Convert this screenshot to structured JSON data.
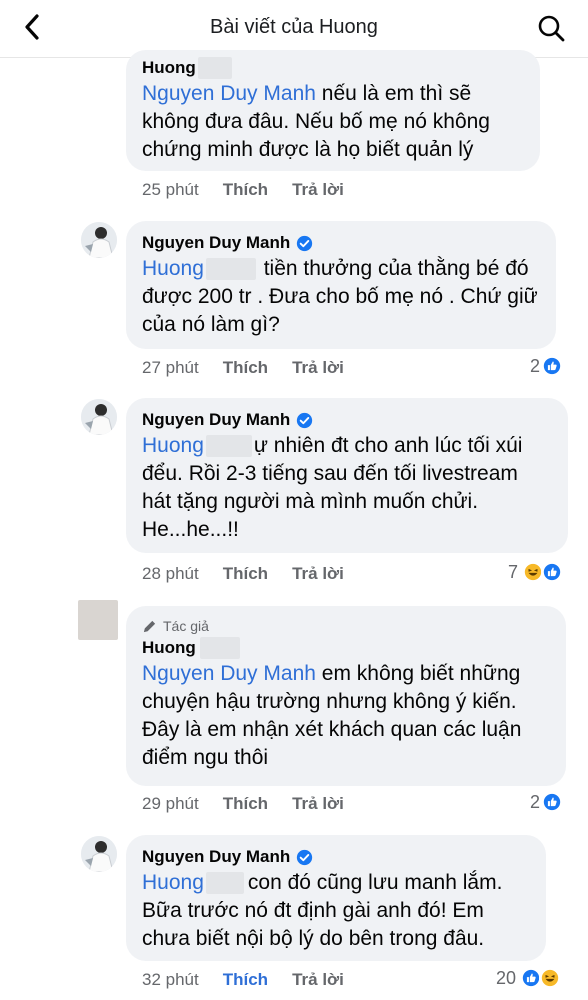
{
  "header": {
    "title": "Bài viết của Huong",
    "back_icon": "chevron-left-icon",
    "search_icon": "search-icon"
  },
  "comments": [
    {
      "author": "Huong",
      "mention": "Nguyen Duy Manh",
      "text": " nếu là em thì sẽ không đưa đâu. Nếu bố mẹ nó không chứng minh được là họ biết quản lý",
      "time": "25 phút",
      "like_label": "Thích",
      "reply_label": "Trả lời"
    },
    {
      "author": "Nguyen Duy Manh",
      "mention": "Huong",
      "text": " tiền thưởng của thằng bé đó được 200 tr . Đưa cho bố mẹ nó . Chứ giữ của nó làm gì?",
      "time": "27 phút",
      "like_label": "Thích",
      "reply_label": "Trả lời",
      "reaction_count": "2"
    },
    {
      "author": "Nguyen Duy Manh",
      "mention": "Huong",
      "text": "ự nhiên đt cho anh lúc tối xúi đểu. Rồi 2-3 tiếng sau đến tối livestream hát tặng người mà mình muốn chửi. He...he...!!",
      "time": "28 phút",
      "like_label": "Thích",
      "reply_label": "Trả lời",
      "reaction_count": "7"
    },
    {
      "tag": "Tác giả",
      "author": "Huong",
      "mention": "Nguyen Duy Manh",
      "text": "  em không biết những chuyện hậu trường nhưng không ý kiến. Đây là em nhận xét khách quan các luận điểm ngu thôi",
      "time": "29 phút",
      "like_label": "Thích",
      "reply_label": "Trả lời",
      "reaction_count": "2"
    },
    {
      "author": "Nguyen Duy Manh",
      "mention": "Huong",
      "text": "con đó cũng lưu manh lắm. Bữa trước nó đt định gài anh đó! Em chưa biết nội bộ lý do bên trong đâu.",
      "time": "32 phút",
      "like_label": "Thích",
      "reply_label": "Trả lời",
      "reaction_count": "20"
    }
  ],
  "colors": {
    "link": "#2f6fd6",
    "bubble": "#f0f2f5",
    "meta": "#65676b",
    "like_blue": "#1877f2",
    "haha_yellow": "#f7b928"
  },
  "icons": {
    "verified": "verified-badge-icon",
    "like": "like-reaction-icon",
    "haha": "haha-reaction-icon",
    "author_tag": "pen-icon"
  }
}
